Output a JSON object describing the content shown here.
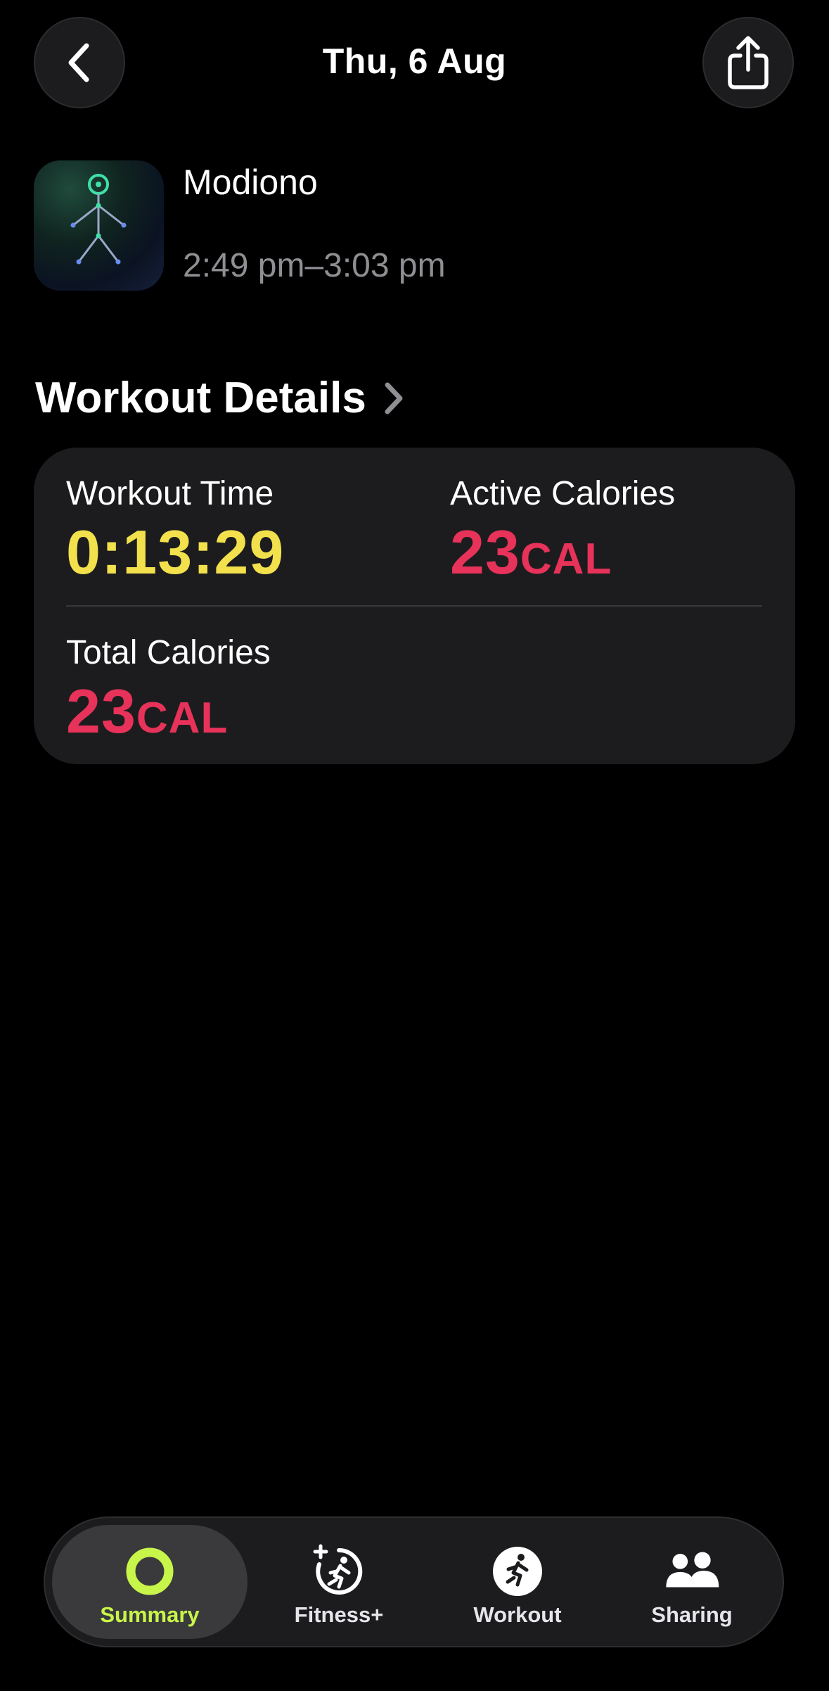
{
  "header": {
    "title": "Thu, 6 Aug",
    "back_icon": "chevron-left-icon",
    "share_icon": "share-icon"
  },
  "workout": {
    "name": "Modiono",
    "time_range": "2:49 pm–3:03 pm",
    "icon": "stick-figure-icon"
  },
  "details": {
    "title": "Workout Details",
    "metrics": [
      {
        "label": "Workout Time",
        "value": "0:13:29",
        "unit": "",
        "color": "#f2e14c"
      },
      {
        "label": "Active Calories",
        "value": "23",
        "unit": "CAL",
        "color": "#e7325a"
      },
      {
        "label": "Total Calories",
        "value": "23",
        "unit": "CAL",
        "color": "#e7325a"
      }
    ]
  },
  "tabbar": {
    "items": [
      {
        "label": "Summary",
        "icon": "activity-ring-icon",
        "active": true
      },
      {
        "label": "Fitness+",
        "icon": "fitness-plus-icon",
        "active": false
      },
      {
        "label": "Workout",
        "icon": "running-figure-icon",
        "active": false
      },
      {
        "label": "Sharing",
        "icon": "people-icon",
        "active": false
      }
    ],
    "accent_color": "#c8f54a"
  }
}
